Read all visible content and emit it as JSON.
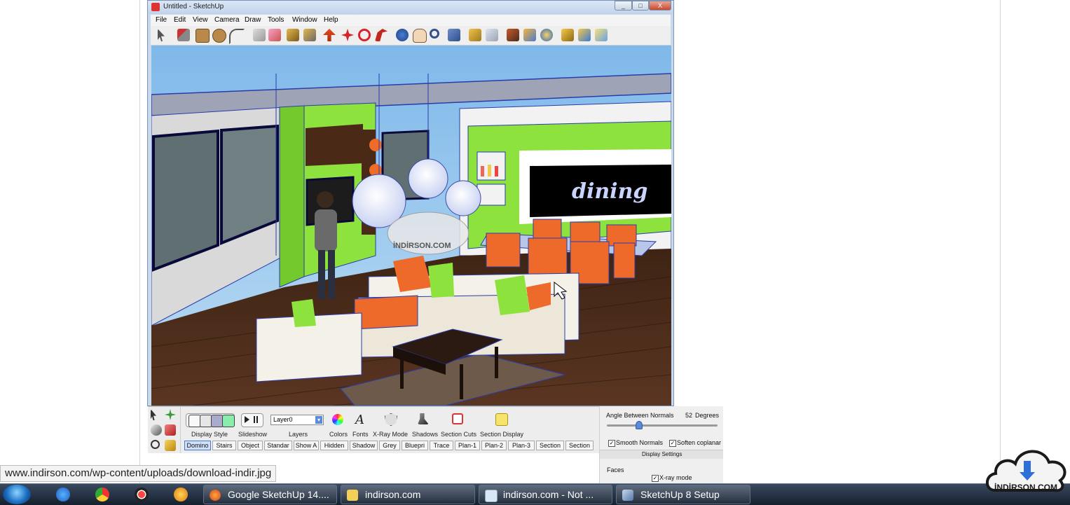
{
  "window": {
    "title": "Untitled - SketchUp",
    "controls": [
      "_",
      "□",
      "X"
    ]
  },
  "menu": [
    "File",
    "Edit",
    "View",
    "Camera",
    "Draw",
    "Tools",
    "Window",
    "Help"
  ],
  "toolbar_icons": [
    "select-icon",
    "pencil-icon",
    "rectangle-icon",
    "circle-icon",
    "arc-icon",
    "eraser-icon",
    "paint-bucket-icon",
    "push-pull-icon",
    "move-icon",
    "rotate-icon",
    "offset-icon",
    "orbit-icon",
    "pan-icon",
    "zoom-icon",
    "zoom-extents-icon",
    "section-icon",
    "walk-icon",
    "position-camera-icon",
    "look-around-icon",
    "warehouse-icon",
    "component-icon",
    "share-icon"
  ],
  "viewport": {
    "sign_text": "dining",
    "watermark_text": "İNDİRSON.COM"
  },
  "styles_panel": {
    "labels": [
      "Display Style",
      "Slideshow",
      "Layers",
      "Colors",
      "Fonts",
      "X-Ray Mode",
      "Shadows",
      "Section Cuts",
      "Section Display"
    ],
    "layer_value": "Layer0",
    "scene_tabs": [
      "Domino",
      "Stairs",
      "Object",
      "Standar",
      "Show A",
      "Hidden",
      "Shadow",
      "Grey",
      "Bluepri",
      "Trace",
      "Plan-1",
      "Plan-2",
      "Plan-3",
      "Section",
      "Section"
    ],
    "active_scene": "Domino"
  },
  "soften_panel": {
    "angle_label": "Angle Between Normals",
    "angle_value": "52",
    "angle_unit": "Degrees",
    "angle_fraction": 0.29,
    "smooth_normals": "Smooth Normals",
    "soften_coplanar": "Soften coplanar",
    "display_settings": "Display Settings",
    "faces": "Faces",
    "xray_mode": "X-ray mode"
  },
  "status_url": "www.indirson.com/wp-content/uploads/download-indir.jpg",
  "taskbar": {
    "tasks": [
      {
        "label": "Google SketchUp 14....",
        "icon": "firefox-icon"
      },
      {
        "label": "indirson.com",
        "icon": "folder-icon"
      },
      {
        "label": "indirson.com - Not ...",
        "icon": "notepad-icon"
      },
      {
        "label": "SketchUp 8 Setup",
        "icon": "installer-icon"
      }
    ]
  },
  "badge": {
    "text": "İNDİRSON.COM"
  },
  "colors": {
    "wall_green": "#8ee23d",
    "floor_brown": "#4a2a19",
    "chair_orange": "#ee6a2a",
    "sky_blue": "#8fc0e8"
  }
}
